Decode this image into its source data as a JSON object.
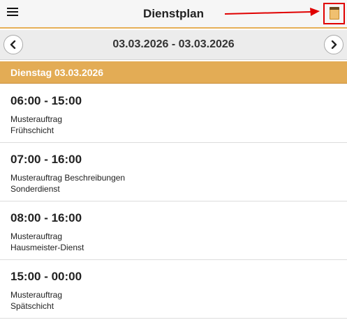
{
  "header": {
    "title": "Dienstplan",
    "menu_icon": "hamburger-icon",
    "calendar_icon": "calendar-icon",
    "highlight_color": "#e00000",
    "accent_color": "#e3ac55"
  },
  "datebar": {
    "range": "03.03.2026 - 03.03.2026",
    "prev_icon": "chevron-left-icon",
    "next_icon": "chevron-right-icon"
  },
  "day": {
    "label": "Dienstag 03.03.2026"
  },
  "shifts": [
    {
      "time": "06:00 - 15:00",
      "order": "Musterauftrag",
      "type": "Frühschicht"
    },
    {
      "time": "07:00 - 16:00",
      "order": "Musterauftrag Beschreibungen",
      "type": "Sonderdienst"
    },
    {
      "time": "08:00 - 16:00",
      "order": "Musterauftrag",
      "type": "Hausmeister-Dienst"
    },
    {
      "time": "15:00 - 00:00",
      "order": "Musterauftrag",
      "type": "Spätschicht"
    }
  ]
}
